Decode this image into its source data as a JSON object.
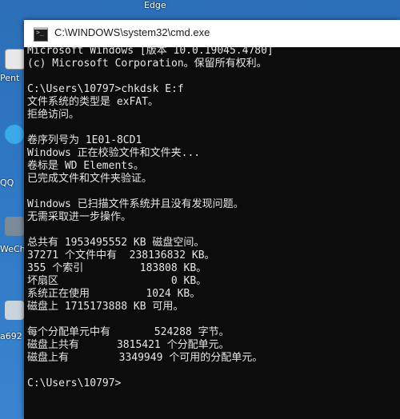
{
  "desktop": {
    "top_label": "Edge",
    "icons": [
      {
        "label": "Pent",
        "icon": "app-icon"
      },
      {
        "label": "QQ",
        "icon": "qq-icon"
      },
      {
        "label": "WeCh",
        "icon": "wechat-icon"
      },
      {
        "label": "a692",
        "icon": "image-file-icon"
      }
    ]
  },
  "window": {
    "title": "C:\\WINDOWS\\system32\\cmd.exe",
    "icon": "cmd-icon"
  },
  "console": {
    "lines": [
      "Microsoft Windows [版本 10.0.19045.4780]",
      "(c) Microsoft Corporation。保留所有权利。",
      "",
      "C:\\Users\\10797>chkdsk E:f",
      "文件系统的类型是 exFAT。",
      "拒绝访问。",
      "",
      "卷序列号为 1E01-8CD1",
      "Windows 正在校验文件和文件夹...",
      "卷标是 WD Elements。",
      "已完成文件和文件夹验证。",
      "",
      "Windows 已扫描文件系统并且没有发现问题。",
      "无需采取进一步操作。",
      "",
      "总共有 1953495552 KB 磁盘空间。",
      "37271 个文件中有  238136832 KB。",
      "355 个索引         183808 KB。",
      "坏扇区                  0 KB。",
      "系统正在使用         1024 KB。",
      "磁盘上 1715173888 KB 可用。",
      "",
      "每个分配单元中有       524288 字节。",
      "磁盘上共有      3815421 个分配单元。",
      "磁盘上有        3349949 个可用的分配单元。",
      "",
      "C:\\Users\\10797>"
    ]
  }
}
